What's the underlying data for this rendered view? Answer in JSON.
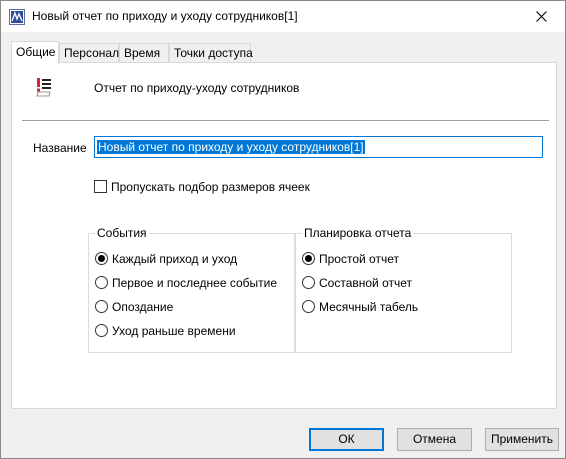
{
  "window": {
    "title": "Новый отчет по приходу и уходу сотрудников[1]",
    "icon": "app-icon",
    "close_icon": "close-icon"
  },
  "tabs": [
    {
      "label": "Общие",
      "active": true
    },
    {
      "label": "Персонал",
      "active": false
    },
    {
      "label": "Время",
      "active": false
    },
    {
      "label": "Точки доступа",
      "active": false
    }
  ],
  "general": {
    "description": "Отчет по приходу-уходу сотрудников",
    "report_icon": "report-list-icon",
    "name_label": "Название",
    "name_value": "Новый отчет по приходу и уходу сотрудников[1]",
    "skip_cell_sizing": {
      "label": "Пропускать подбор размеров ячеек",
      "checked": false
    }
  },
  "events": {
    "title": "События",
    "options": [
      {
        "label": "Каждый приход и уход",
        "selected": true
      },
      {
        "label": "Первое и последнее событие",
        "selected": false
      },
      {
        "label": "Опоздание",
        "selected": false
      },
      {
        "label": "Уход раньше времени",
        "selected": false
      }
    ]
  },
  "layout": {
    "title": "Планировка отчета",
    "options": [
      {
        "label": "Простой отчет",
        "selected": true
      },
      {
        "label": "Составной отчет",
        "selected": false
      },
      {
        "label": "Месячный табель",
        "selected": false
      }
    ]
  },
  "buttons": {
    "ok": "ОК",
    "cancel": "Отмена",
    "apply": "Применить"
  },
  "colors": {
    "accent": "#0078d7",
    "report_icon_red": "#d9262b"
  }
}
